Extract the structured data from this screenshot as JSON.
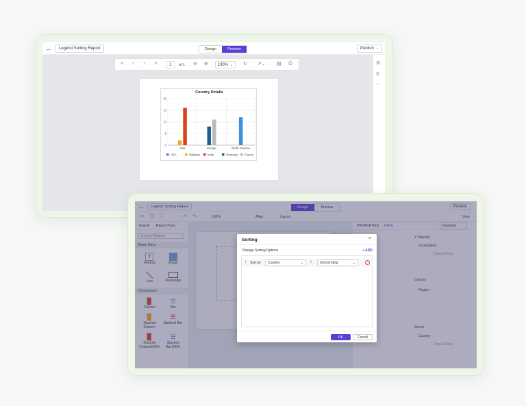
{
  "designer": {
    "report_name": "Legend Sorting Report",
    "tabs": [
      "Design",
      "Preview"
    ],
    "publish_label": "Publish",
    "view_label": "View",
    "page_number": "1",
    "page_of": "of 1",
    "zoom": "100%"
  },
  "chart_data": {
    "type": "bar",
    "title": "Country Details",
    "categories": [
      "Asia",
      "Europe",
      "North America"
    ],
    "ylim": [
      0,
      20
    ],
    "yticks": [
      "0",
      "5",
      "10",
      "15",
      "20"
    ],
    "series": [
      {
        "name": "USA",
        "color": "#3d8fe0",
        "values": [
          null,
          null,
          12
        ]
      },
      {
        "name": "Pakistan",
        "color": "#f5a623",
        "values": [
          2,
          null,
          null
        ]
      },
      {
        "name": "India",
        "color": "#d5441c",
        "values": [
          16,
          null,
          null
        ]
      },
      {
        "name": "Germany",
        "color": "#1f5f8b",
        "values": [
          null,
          8,
          null
        ]
      },
      {
        "name": "France",
        "color": "#b9b9bd",
        "values": [
          null,
          11,
          null
        ]
      }
    ],
    "legend_position": "bottom"
  },
  "panels": {
    "data_tab": "Data A",
    "report_parts_tab": "Report Parts",
    "search_placeholder": "Search Widgets",
    "sections": {
      "basic": "Basic Items",
      "comparison": "Comparison"
    },
    "widgets": [
      "Textbox",
      "Image",
      "Line",
      "Rectangle",
      "Column",
      "Bar",
      "Stacked Column",
      "Stacked Bar",
      "Stacked Column100%",
      "Stacked Bar100%"
    ],
    "properties_tab": "PROPERTIES",
    "data_tab2": "DATA",
    "dataset": "DataSet1",
    "y_values": "Y Value(s)",
    "y_field": "Sum(Sales)",
    "drag_drop": "Drag & Drop",
    "column_label": "Column",
    "column_field": "Region",
    "series_label": "Series",
    "series_field": "Country",
    "align_label": "Align",
    "layout_label": "Layout"
  },
  "sorting_dialog": {
    "title": "Sorting",
    "subtitle": "Change Sorting Options",
    "add_label": "+ ADD",
    "sort_by_label": "Sort by",
    "field_value": "Country",
    "order_value": "Descending",
    "ok_label": "OK",
    "cancel_label": "Cancel"
  }
}
